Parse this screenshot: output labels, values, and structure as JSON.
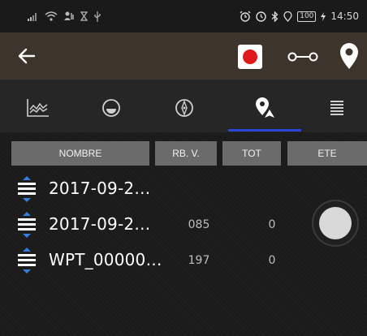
{
  "status_bar": {
    "time": "14:50",
    "battery": "100",
    "left_icons": [
      "signal-icon",
      "wifi-icon",
      "data-transfer-icon",
      "hourglass-icon",
      "usb-icon"
    ],
    "right_icons": [
      "alarm-icon",
      "clock-icon",
      "bluetooth-icon",
      "location-icon",
      "battery-icon"
    ]
  },
  "toolbar": {
    "back_icon": "back-arrow-icon",
    "record_color": "#e0181b",
    "route_icon": "route-icon",
    "waypoint_icon": "map-pin-icon"
  },
  "tabs": [
    {
      "icon": "graph-icon",
      "active": false
    },
    {
      "icon": "gauge-icon",
      "active": false
    },
    {
      "icon": "compass-icon",
      "active": false
    },
    {
      "icon": "waypoint-icon",
      "active": true
    },
    {
      "icon": "list-icon",
      "active": false
    }
  ],
  "accent_color": "#2a46d8",
  "table": {
    "headers": [
      "NOMBRE",
      "RB. V.",
      "TOT",
      "ETE"
    ],
    "rows": [
      {
        "name": "2017-09-2…",
        "rb": "",
        "tot": ""
      },
      {
        "name": "2017-09-2…",
        "rb": "085",
        "tot": "0"
      },
      {
        "name": "WPT_00000…",
        "rb": "197",
        "tot": "0"
      }
    ]
  }
}
